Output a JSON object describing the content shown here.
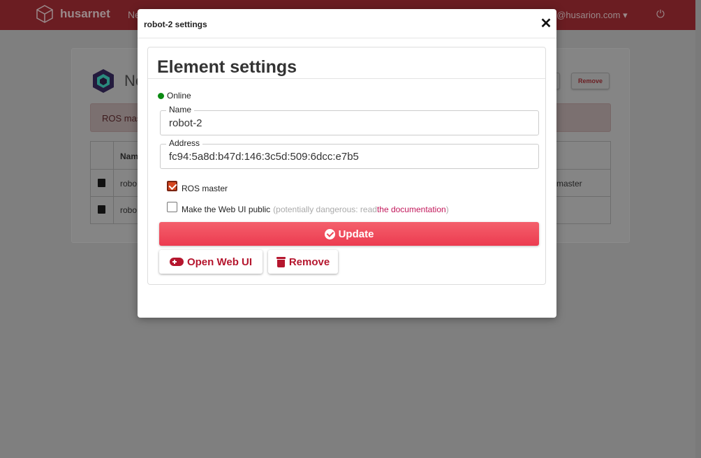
{
  "navbar": {
    "brand": "husarnet",
    "nav_link": "Ne",
    "user_email": "e@husarion.com",
    "user_caret": "▾",
    "power_icon": "⏻"
  },
  "background": {
    "network_title": "Ne",
    "buttons": [
      "e",
      "Remove"
    ],
    "alert_text": "ROS mas",
    "table": {
      "header": "Nam",
      "rows": [
        {
          "name": "robo",
          "right_text": "master"
        },
        {
          "name": "robo",
          "right_text": ""
        }
      ]
    }
  },
  "modal": {
    "title": "robot-2 settings",
    "close_symbol": "✕",
    "panel_title": "Element settings",
    "status": {
      "label": "Online",
      "color": "#0a8a12"
    },
    "name_field": {
      "legend": "Name",
      "value": "robot-2"
    },
    "address_field": {
      "legend": "Address",
      "value": "fc94:5a8d:b47d:146:3c5d:509:6dcc:e7b5"
    },
    "ros_master": {
      "label": "ROS master",
      "checked": true
    },
    "web_ui_public": {
      "label": "Make the Web UI public",
      "warning_prefix": "(potentially dangerous: read ",
      "link_text": "the documentation",
      "warning_suffix": ")",
      "checked": false
    },
    "update_button": "Update",
    "open_web_ui_button": "Open Web UI",
    "remove_button": "Remove"
  },
  "colors": {
    "accent": "#ec3b50",
    "danger_text": "#b5162e",
    "link": "#c2185b",
    "online": "#0a8a12"
  }
}
